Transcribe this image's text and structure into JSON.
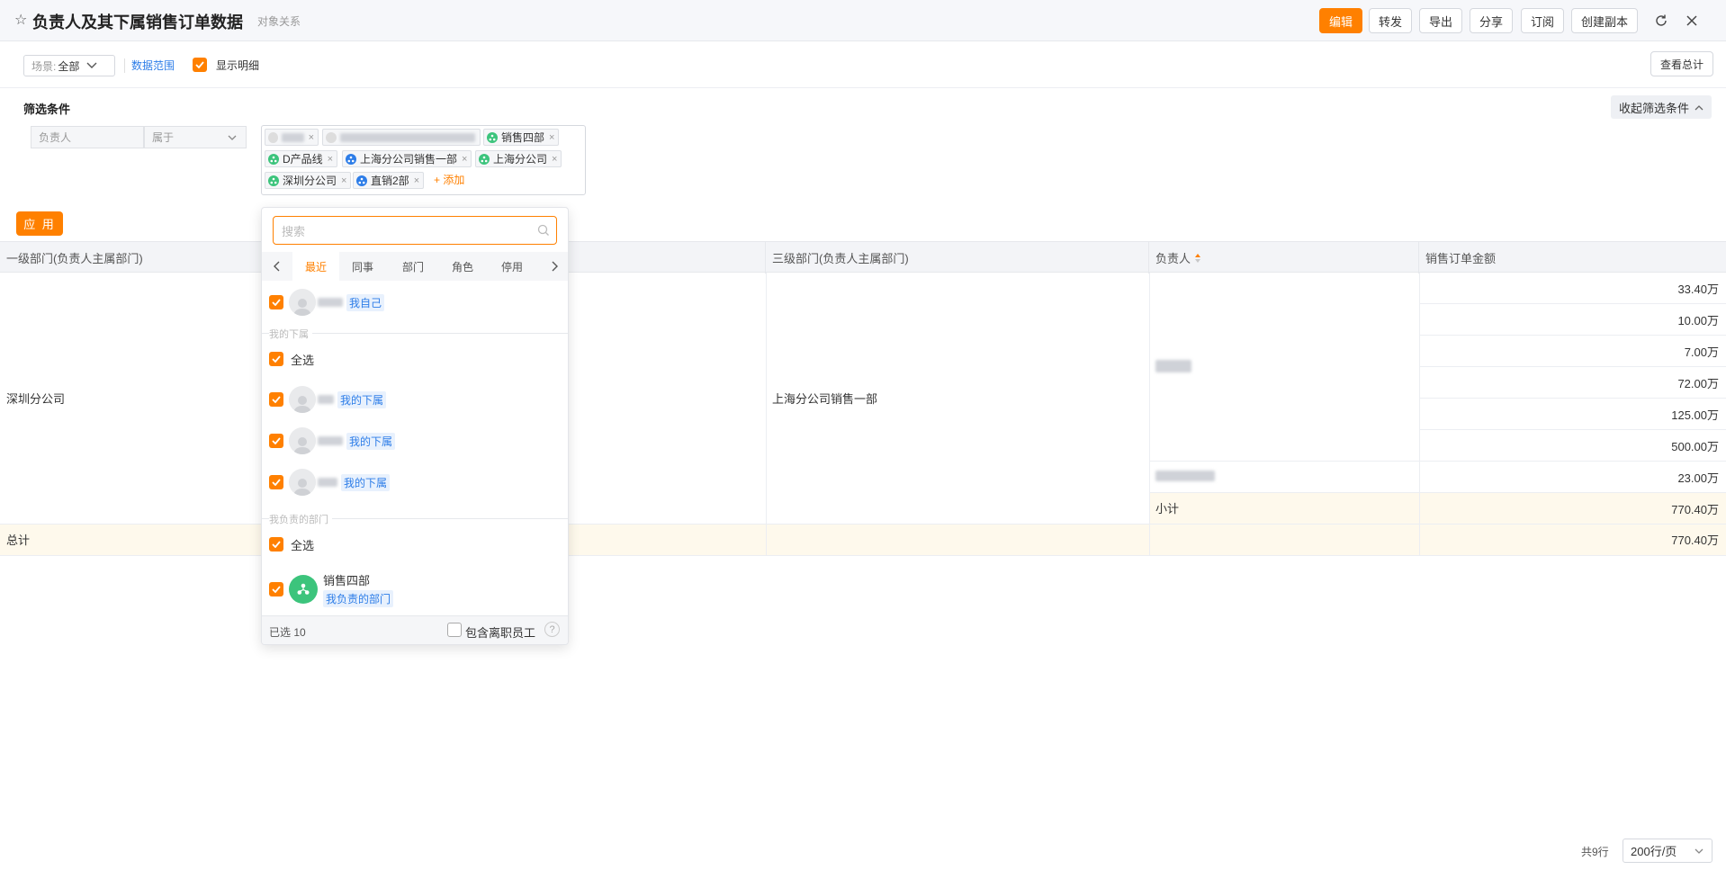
{
  "header": {
    "title": "负责人及其下属销售订单数据",
    "subtitle": "对象关系",
    "buttons": {
      "edit": "编辑",
      "forward": "转发",
      "export": "导出",
      "share": "分享",
      "subscribe": "订阅",
      "copy": "创建副本"
    }
  },
  "toolbar": {
    "scene_label": "场景:",
    "scene_value": "全部",
    "data_range": "数据范围",
    "show_detail": "显示明细",
    "view_total": "查看总计"
  },
  "filter": {
    "title": "筛选条件",
    "collapse": "收起筛选条件",
    "field": "负责人",
    "operator": "属于",
    "tags": [
      "销售四部",
      "D产品线",
      "上海分公司销售一部",
      "上海分公司",
      "深圳分公司",
      "直销2部"
    ],
    "add": "+ 添加",
    "apply": "应 用"
  },
  "table": {
    "headers": [
      "一级部门(负责人主属部门)",
      "三级部门(负责人主属部门)",
      "负责人",
      "销售订单金额"
    ],
    "level1": "深圳分公司",
    "level3": "上海分公司销售一部",
    "amounts": [
      "33.40万",
      "10.00万",
      "7.00万",
      "72.00万",
      "125.00万",
      "500.00万",
      "23.00万"
    ],
    "subtotal_label": "小计",
    "subtotal_value": "770.40万",
    "total_label": "总计",
    "total_value": "770.40万"
  },
  "picker": {
    "search_placeholder": "搜索",
    "tabs": [
      "最近",
      "同事",
      "部门",
      "角色",
      "停用"
    ],
    "self_badge": "我自己",
    "sub_section": "我的下属",
    "select_all": "全选",
    "sub_badge": "我的下属",
    "dept_section": "我负责的部门",
    "dept_name": "销售四部",
    "dept_badge": "我负责的部门",
    "selected_count": "已选 10",
    "include_resigned": "包含离职员工"
  },
  "pager": {
    "total": "共9行",
    "per_page": "200行/页"
  },
  "colors": {
    "accent": "#ff8000",
    "link": "#2d7de8",
    "dept_green": "#3cc47c",
    "dept_blue": "#2d7de8"
  }
}
